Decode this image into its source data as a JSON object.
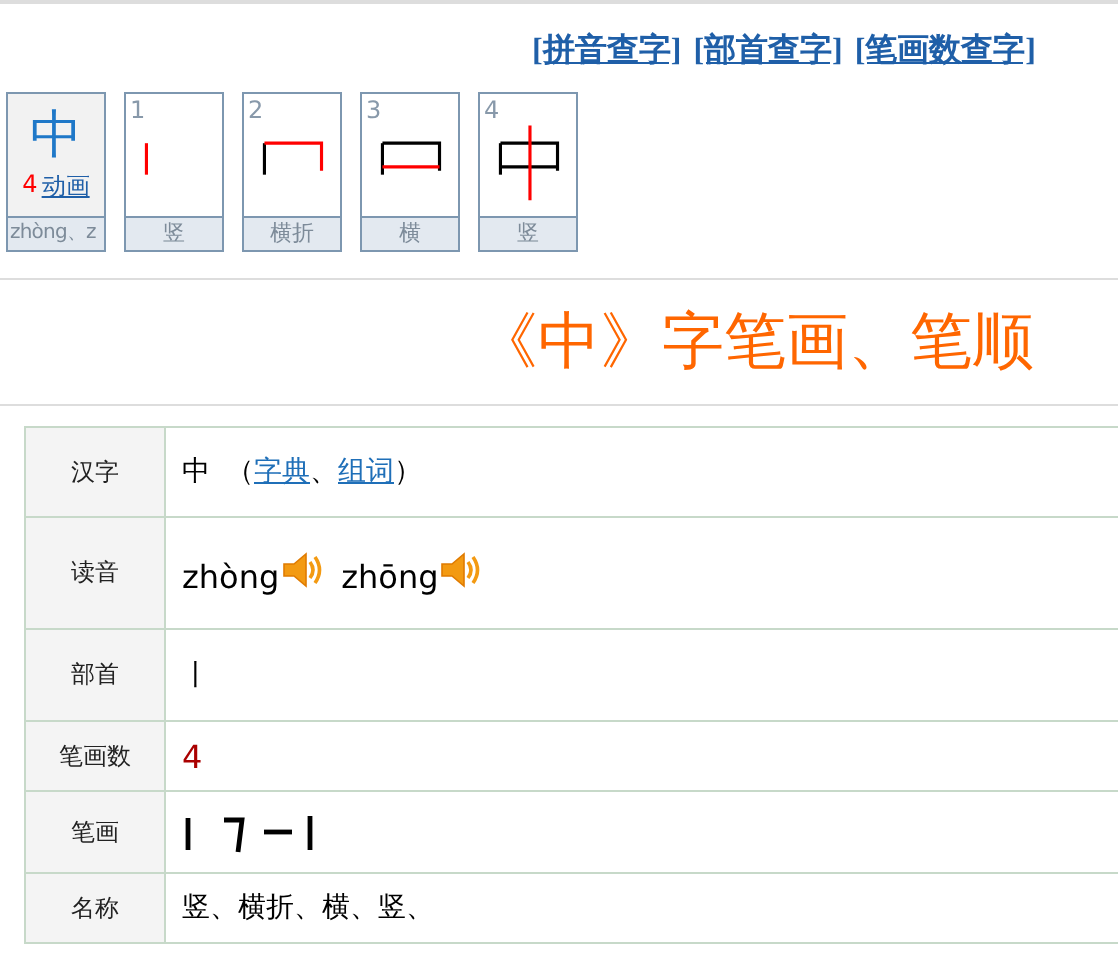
{
  "search_links": [
    "[拼音查字]",
    "[部首查字]",
    "[笔画数查字]"
  ],
  "character_card": {
    "character": "中",
    "stroke_count": "4",
    "animation_link": "动画",
    "pinyin": "zhòng、z"
  },
  "stroke_cards": [
    {
      "number": "1",
      "name": "竖"
    },
    {
      "number": "2",
      "name": "横折"
    },
    {
      "number": "3",
      "name": "横"
    },
    {
      "number": "4",
      "name": "竖"
    }
  ],
  "title": "《中》字笔画、笔顺",
  "table": {
    "rows": [
      {
        "kind": "hanzi",
        "label": "汉字",
        "character": "中",
        "open": "（",
        "links": [
          "字典",
          "组词"
        ],
        "separator": "、",
        "close": "）"
      },
      {
        "kind": "readings",
        "label": "读音",
        "readings": [
          "zhòng",
          "zhōng"
        ]
      },
      {
        "kind": "text",
        "label": "部首",
        "value": "丨"
      },
      {
        "kind": "count",
        "label": "笔画数",
        "value": "4"
      },
      {
        "kind": "strokes",
        "label": "笔画"
      },
      {
        "kind": "text",
        "label": "名称",
        "value": "竖、横折、横、竖、"
      }
    ]
  }
}
